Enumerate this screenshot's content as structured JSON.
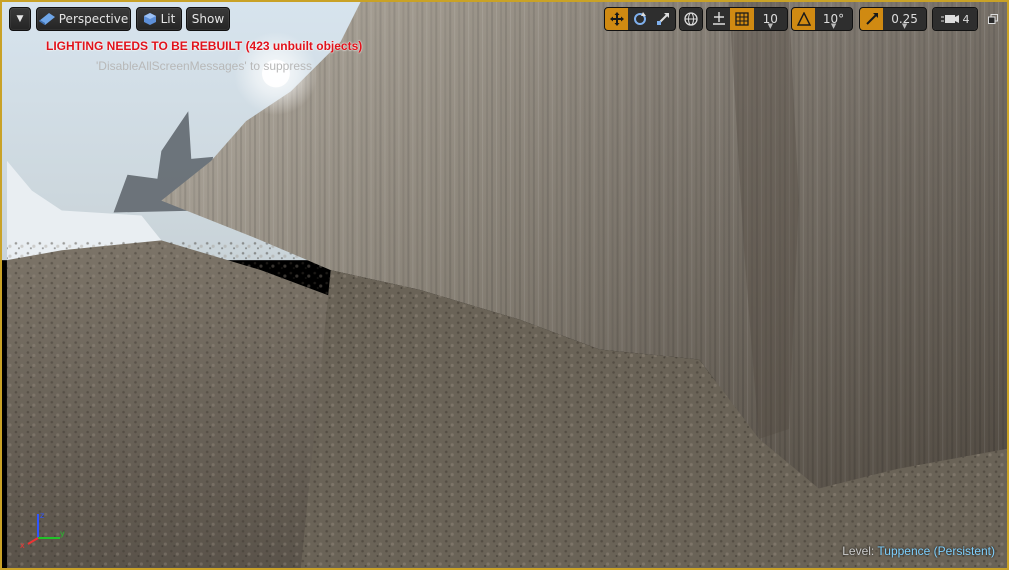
{
  "toolbar": {
    "dropdown_icon": "chevron-down-icon",
    "perspective_label": "Perspective",
    "perspective_icon": "camera-view-icon",
    "lit_label": "Lit",
    "lit_icon": "sphere-icon",
    "show_label": "Show",
    "transform_tools": [
      "move-icon",
      "rotate-icon",
      "scale-icon"
    ],
    "world_local_icon": "globe-icon",
    "surface_snap_icon": "surface-snap-icon",
    "grid_snap_icon": "grid-icon",
    "grid_snap_value": "10",
    "rotation_snap_icon": "angle-icon",
    "rotation_snap_value": "10°",
    "scale_snap_icon": "scale-snap-icon",
    "scale_snap_value": "0.25",
    "camera_speed_icon": "camera-speed-icon",
    "camera_speed_value": "4",
    "restore_icon": "restore-window-icon"
  },
  "messages": {
    "warning": "LIGHTING NEEDS TO BE REBUILT (423 unbuilt objects)",
    "hint": "'DisableAllScreenMessages' to suppress"
  },
  "status": {
    "level_label": "Level:",
    "level_name": "Tuppence (Persistent)"
  },
  "colors": {
    "accent": "#d08a12",
    "warning": "#e0121b",
    "border": "#c9a227",
    "level_name": "#7fd1ff"
  }
}
